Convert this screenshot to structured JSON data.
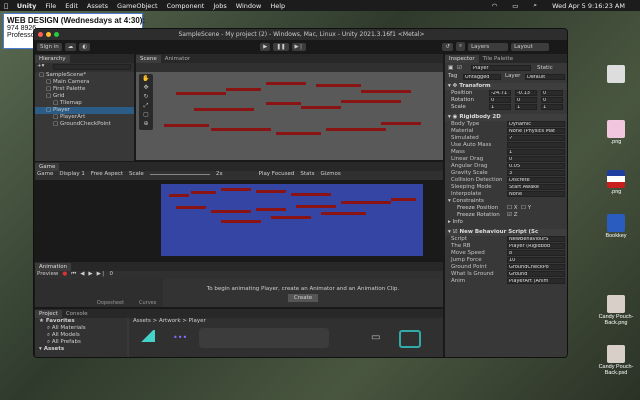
{
  "menubar": {
    "app": "Unity",
    "items": [
      "File",
      "Edit",
      "Assets",
      "GameObject",
      "Component",
      "Jobs",
      "Window",
      "Help"
    ],
    "clock": "Wed Apr 5  9:16:23 AM"
  },
  "sticky": {
    "title": "WEB DESIGN (Wednesdays at 4:30):",
    "line1": "974 8926",
    "line2": "Professor"
  },
  "window": {
    "title": "SampleScene - My project (2) - Windows, Mac, Linux - Unity 2021.3.16f1 <Metal>"
  },
  "toolbar": {
    "signin": "Sign in",
    "layers": "Layers",
    "layout": "Layout"
  },
  "hierarchy": {
    "tab": "Hierarchy",
    "items": [
      {
        "label": "SampleScene*",
        "level": 0,
        "selected": false
      },
      {
        "label": "Main Camera",
        "level": 1,
        "selected": false
      },
      {
        "label": "First Palette",
        "level": 1,
        "selected": false
      },
      {
        "label": "Grid",
        "level": 1,
        "selected": false
      },
      {
        "label": "Tilemap",
        "level": 2,
        "selected": false
      },
      {
        "label": "Player",
        "level": 1,
        "selected": true
      },
      {
        "label": "PlayerArt",
        "level": 2,
        "selected": false
      },
      {
        "label": "GroundCheckPoint",
        "level": 2,
        "selected": false
      }
    ]
  },
  "scene": {
    "tab": "Scene",
    "tab2": "Animator"
  },
  "game": {
    "tab": "Game",
    "mode": "Game",
    "display": "Display 1",
    "aspect": "Free Aspect",
    "scale_label": "Scale",
    "scale_value": "2x",
    "play_focused": "Play Focused",
    "stats": "Stats",
    "gizmos": "Gizmos"
  },
  "animation": {
    "tab": "Animation",
    "preview": "Preview",
    "frame": "0",
    "message": "To begin animating Player, create an Animator and an Animation Clip.",
    "create": "Create",
    "dopesheet": "Dopesheet",
    "curves": "Curves"
  },
  "project": {
    "tab": "Project",
    "tab2": "Console",
    "breadcrumb": [
      "Assets",
      "Artwork",
      "Player"
    ],
    "favorites_label": "Favorites",
    "favorites": [
      "All Materials",
      "All Models",
      "All Prefabs"
    ],
    "assets_label": "Assets",
    "assets_child": "Artwork",
    "count": "8"
  },
  "inspector": {
    "tab": "Inspector",
    "tab2": "Tile Palette",
    "object_name": "Player",
    "static": "Static",
    "tag_label": "Tag",
    "tag_value": "Untagged",
    "layer_label": "Layer",
    "layer_value": "Default",
    "transform": {
      "title": "Transform",
      "position": {
        "label": "Position",
        "x": "-24.71",
        "y": "-0.13",
        "z": "0"
      },
      "rotation": {
        "label": "Rotation",
        "x": "0",
        "y": "0",
        "z": "0"
      },
      "scale": {
        "label": "Scale",
        "x": "1",
        "y": "1",
        "z": "1"
      }
    },
    "rigidbody": {
      "title": "Rigidbody 2D",
      "fields": [
        {
          "label": "Body Type",
          "value": "Dynamic"
        },
        {
          "label": "Material",
          "value": "None (Physics Mat"
        },
        {
          "label": "Simulated",
          "value": "✓"
        },
        {
          "label": "Use Auto Mass",
          "value": ""
        },
        {
          "label": "Mass",
          "value": "1"
        },
        {
          "label": "Linear Drag",
          "value": "0"
        },
        {
          "label": "Angular Drag",
          "value": "0.05"
        },
        {
          "label": "Gravity Scale",
          "value": "3"
        },
        {
          "label": "Collision Detection",
          "value": "Discrete"
        },
        {
          "label": "Sleeping Mode",
          "value": "Start Awake"
        },
        {
          "label": "Interpolate",
          "value": "None"
        }
      ],
      "constraints": "Constraints",
      "freeze_position": {
        "label": "Freeze Position",
        "x": "X",
        "y": "Y"
      },
      "freeze_rotation": {
        "label": "Freeze Rotation",
        "z": "Z"
      },
      "info": "Info"
    },
    "script": {
      "title": "New Behaviour Script (Sc",
      "fields": [
        {
          "label": "Script",
          "value": "NewBehaviourS"
        },
        {
          "label": "The RB",
          "value": "Player (Rigidbod"
        },
        {
          "label": "Move Speed",
          "value": "8"
        },
        {
          "label": "Jump Force",
          "value": "10"
        },
        {
          "label": "Ground Point",
          "value": "GroundCheckPo"
        },
        {
          "label": "What Is Ground",
          "value": "Ground"
        },
        {
          "label": "Anim",
          "value": "PlayerArt (Anim"
        }
      ]
    }
  },
  "desktop_icons": [
    {
      "label": ".png"
    },
    {
      "label": ".png"
    },
    {
      "label": "Bookkey"
    },
    {
      "label": "Candy Pouch-Back.png"
    },
    {
      "label": "Candy Pouch-Back.psd"
    }
  ]
}
